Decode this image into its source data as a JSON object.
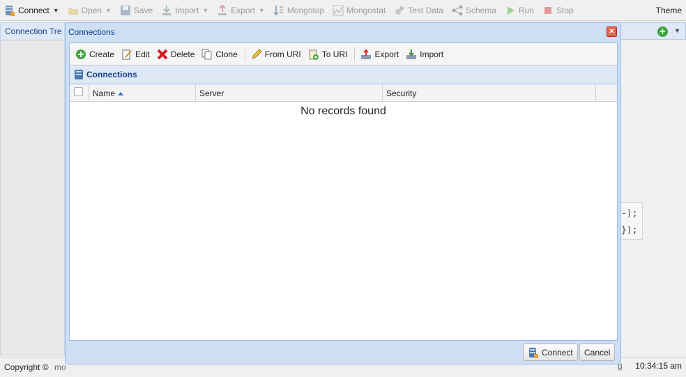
{
  "topbar": {
    "items": [
      {
        "label": "Connect",
        "icon": "database-icon",
        "caret": true,
        "enabled": true
      },
      {
        "label": "Open",
        "icon": "folder-icon",
        "caret": true,
        "enabled": false
      },
      {
        "label": "Save",
        "icon": "save-icon",
        "caret": false,
        "enabled": false
      },
      {
        "label": "Import",
        "icon": "import-icon",
        "caret": true,
        "enabled": false
      },
      {
        "label": "Export",
        "icon": "export-icon",
        "caret": true,
        "enabled": false
      },
      {
        "label": "Mongotop",
        "icon": "sort-icon",
        "caret": false,
        "enabled": false
      },
      {
        "label": "Mongostat",
        "icon": "chart-icon",
        "caret": false,
        "enabled": false
      },
      {
        "label": "Test Data",
        "icon": "gears-icon",
        "caret": false,
        "enabled": false
      },
      {
        "label": "Schema",
        "icon": "schema-icon",
        "caret": false,
        "enabled": false
      },
      {
        "label": "Run",
        "icon": "play-icon",
        "caret": false,
        "enabled": false
      },
      {
        "label": "Stop",
        "icon": "stop-icon",
        "caret": false,
        "enabled": false
      }
    ],
    "theme_label": "Theme"
  },
  "left_panel": {
    "title": "Connection Tre"
  },
  "editor_fragment": {
    "line1": "-);",
    "line2": "});"
  },
  "status": {
    "copyright": "Copyright ©",
    "fragment": "mo",
    "fragment2": "g",
    "time": "10:34:15 am"
  },
  "modal": {
    "title": "Connections",
    "toolbar": {
      "create": "Create",
      "edit": "Edit",
      "delete": "Delete",
      "clone": "Clone",
      "from_uri": "From URI",
      "to_uri": "To URI",
      "export": "Export",
      "import": "Import"
    },
    "panel_title": "Connections",
    "columns": [
      "Name",
      "Server",
      "Security"
    ],
    "empty_text": "No records found",
    "footer": {
      "connect": "Connect",
      "cancel": "Cancel"
    }
  },
  "colors": {
    "accent": "#15428b",
    "header_bg": "#dfe8f6",
    "modal_border": "#99bbe8"
  }
}
